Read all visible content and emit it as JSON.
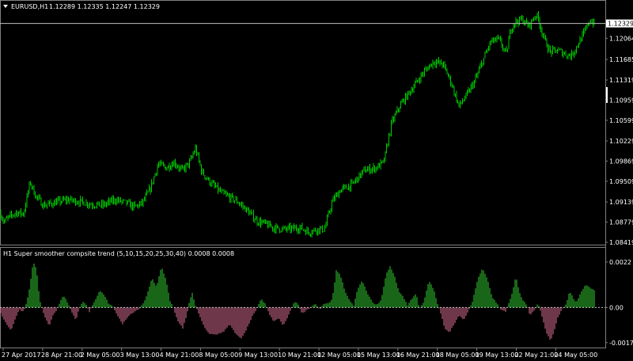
{
  "main_panel": {
    "symbol_label": "EURUSD,H1",
    "ohlc": "1.12289 1.12335 1.12247 1.12329",
    "current_price": "1.12329",
    "price_axis": [
      "1.12409",
      "1.12064",
      "1.11685",
      "1.11319",
      "1.10959",
      "1.10599",
      "1.10229",
      "1.09869",
      "1.09509",
      "1.09139",
      "1.08779",
      "1.08419"
    ]
  },
  "indicator_panel": {
    "title": "H1 Super smoother compsite trend (5,10,15,20,25,30,40) 0.0008 0.0008",
    "axis": [
      "0.0022",
      "0.00",
      "-0.0017"
    ]
  },
  "time_axis": [
    "27 Apr 2017",
    "28 Apr 21:00",
    "2 May 05:00",
    "3 May 13:00",
    "4 May 21:00",
    "8 May 05:00",
    "9 May 13:00",
    "10 May 21:00",
    "12 May 05:00",
    "15 May 13:00",
    "16 May 21:00",
    "18 May 05:00",
    "19 May 13:00",
    "22 May 21:00",
    "24 May 05:00"
  ],
  "colors": {
    "background": "#000000",
    "candle": "#00c800",
    "grid_line": "#c0c0c0",
    "hist_positive": "#32cd32",
    "hist_negative": "#db7093",
    "text": "#ffffff"
  },
  "chart_data": [
    {
      "type": "candlestick",
      "title": "EURUSD,H1",
      "ylim": [
        1.0842,
        1.1255
      ],
      "current_price": 1.12329,
      "x_tick_labels": [
        "27 Apr 2017",
        "28 Apr 21:00",
        "2 May 05:00",
        "3 May 13:00",
        "4 May 21:00",
        "8 May 05:00",
        "9 May 13:00",
        "10 May 21:00",
        "12 May 05:00",
        "15 May 13:00",
        "16 May 21:00",
        "18 May 05:00",
        "19 May 13:00",
        "22 May 21:00",
        "24 May 05:00"
      ],
      "close_path": [
        [
          0,
          1.0895
        ],
        [
          2,
          1.0888
        ],
        [
          5,
          1.0878
        ],
        [
          10,
          1.0885
        ],
        [
          20,
          1.0895
        ],
        [
          30,
          1.0893
        ],
        [
          38,
          1.095
        ],
        [
          45,
          1.0925
        ],
        [
          55,
          1.0908
        ],
        [
          70,
          1.0913
        ],
        [
          85,
          1.0918
        ],
        [
          100,
          1.0915
        ],
        [
          115,
          1.091
        ],
        [
          130,
          1.0908
        ],
        [
          145,
          1.0918
        ],
        [
          160,
          1.0912
        ],
        [
          170,
          1.0905
        ],
        [
          180,
          1.0912
        ],
        [
          190,
          1.0938
        ],
        [
          200,
          1.0982
        ],
        [
          210,
          1.0975
        ],
        [
          220,
          1.0985
        ],
        [
          230,
          1.097
        ],
        [
          240,
          1.0985
        ],
        [
          247,
          1.101
        ],
        [
          255,
          1.0968
        ],
        [
          265,
          1.095
        ],
        [
          280,
          1.093
        ],
        [
          300,
          1.0915
        ],
        [
          315,
          1.0895
        ],
        [
          325,
          1.088
        ],
        [
          335,
          1.0875
        ],
        [
          345,
          1.0868
        ],
        [
          360,
          1.0865
        ],
        [
          380,
          1.0868
        ],
        [
          390,
          1.086
        ],
        [
          400,
          1.0865
        ],
        [
          410,
          1.0865
        ],
        [
          420,
          1.0915
        ],
        [
          430,
          1.0935
        ],
        [
          445,
          1.0945
        ],
        [
          460,
          1.097
        ],
        [
          475,
          1.0975
        ],
        [
          485,
          1.0985
        ],
        [
          495,
          1.1055
        ],
        [
          505,
          1.1085
        ],
        [
          515,
          1.1105
        ],
        [
          525,
          1.1125
        ],
        [
          535,
          1.1145
        ],
        [
          548,
          1.1165
        ],
        [
          560,
          1.116
        ],
        [
          570,
          1.1128
        ],
        [
          580,
          1.1085
        ],
        [
          590,
          1.1105
        ],
        [
          600,
          1.113
        ],
        [
          610,
          1.1165
        ],
        [
          620,
          1.12
        ],
        [
          630,
          1.1205
        ],
        [
          640,
          1.1178
        ],
        [
          645,
          1.122
        ],
        [
          650,
          1.1235
        ],
        [
          660,
          1.124
        ],
        [
          668,
          1.1228
        ],
        [
          678,
          1.125
        ],
        [
          688,
          1.1205
        ],
        [
          695,
          1.1182
        ],
        [
          705,
          1.1185
        ],
        [
          715,
          1.1178
        ],
        [
          722,
          1.1175
        ],
        [
          730,
          1.1195
        ],
        [
          738,
          1.1215
        ],
        [
          745,
          1.1238
        ],
        [
          752,
          1.1233
        ]
      ]
    },
    {
      "type": "histogram",
      "title": "H1 Super smoother compsite trend (5,10,15,20,25,30,40) 0.0008 0.0008",
      "ylim": [
        -0.0019,
        0.00235
      ],
      "y_tick_labels": [
        "0.0022",
        "0.00",
        "-0.0017"
      ],
      "positive_color": "#32cd32",
      "negative_color": "#db7093",
      "profile": [
        [
          0,
          -0.0002
        ],
        [
          8,
          -0.0008
        ],
        [
          14,
          -0.0011
        ],
        [
          18,
          -0.0007
        ],
        [
          24,
          -0.0001
        ],
        [
          30,
          -0.0002
        ],
        [
          36,
          0.0006
        ],
        [
          42,
          0.0022
        ],
        [
          46,
          0.0019
        ],
        [
          50,
          0.0004
        ],
        [
          56,
          -0.0004
        ],
        [
          62,
          -0.0009
        ],
        [
          67,
          -0.0004
        ],
        [
          72,
          -0.0001
        ],
        [
          80,
          0.0006
        ],
        [
          86,
          0.0002
        ],
        [
          90,
          -0.0002
        ],
        [
          96,
          -0.0006
        ],
        [
          100,
          -0.0001
        ],
        [
          104,
          0.0003
        ],
        [
          108,
          0.0002
        ],
        [
          113,
          -0.0002
        ],
        [
          118,
          0.0002
        ],
        [
          126,
          0.0008
        ],
        [
          132,
          0.0006
        ],
        [
          137,
          0.0002
        ],
        [
          142,
          0.0001
        ],
        [
          147,
          -0.0003
        ],
        [
          155,
          -0.0008
        ],
        [
          163,
          -0.0004
        ],
        [
          170,
          -0.0002
        ],
        [
          176,
          -0.0001
        ],
        [
          184,
          0.0004
        ],
        [
          192,
          0.0014
        ],
        [
          198,
          0.001
        ],
        [
          204,
          0.002
        ],
        [
          210,
          0.0013
        ],
        [
          215,
          0.0003
        ],
        [
          218,
          0.0001
        ],
        [
          224,
          -0.0006
        ],
        [
          231,
          -0.001
        ],
        [
          236,
          -0.0004
        ],
        [
          240,
          0.0004
        ],
        [
          243,
          0.0007
        ],
        [
          247,
          0.0001
        ],
        [
          252,
          -0.0004
        ],
        [
          260,
          -0.0011
        ],
        [
          266,
          -0.0013
        ],
        [
          274,
          -0.0013
        ],
        [
          282,
          -0.0012
        ],
        [
          290,
          -0.0008
        ],
        [
          298,
          -0.0013
        ],
        [
          305,
          -0.0015
        ],
        [
          310,
          -0.0012
        ],
        [
          318,
          -0.0005
        ],
        [
          324,
          -0.0001
        ],
        [
          330,
          0.0004
        ],
        [
          335,
          0.0002
        ],
        [
          340,
          -0.0003
        ],
        [
          346,
          -0.0007
        ],
        [
          352,
          -0.0005
        ],
        [
          358,
          -0.0009
        ],
        [
          363,
          -0.0005
        ],
        [
          368,
          -0.0001
        ],
        [
          372,
          0.0003
        ],
        [
          376,
          0.0002
        ],
        [
          382,
          -0.0003
        ],
        [
          388,
          -0.0001
        ],
        [
          393,
          0.0
        ],
        [
          398,
          0.0002
        ],
        [
          404,
          -0.0001
        ],
        [
          410,
          0.0002
        ],
        [
          416,
          0.0002
        ],
        [
          420,
          0.0004
        ],
        [
          425,
          0.0018
        ],
        [
          430,
          0.0016
        ],
        [
          436,
          0.0008
        ],
        [
          442,
          0.0003
        ],
        [
          447,
          0.0001
        ],
        [
          452,
          0.0009
        ],
        [
          458,
          0.0013
        ],
        [
          464,
          0.0007
        ],
        [
          470,
          0.0003
        ],
        [
          476,
          0.0001
        ],
        [
          482,
          0.0004
        ],
        [
          488,
          0.0016
        ],
        [
          493,
          0.002
        ],
        [
          498,
          0.0016
        ],
        [
          504,
          0.0008
        ],
        [
          510,
          0.0005
        ],
        [
          515,
          0.0001
        ],
        [
          520,
          0.0004
        ],
        [
          526,
          0.0007
        ],
        [
          530,
          -0.0001
        ],
        [
          536,
          0.0003
        ],
        [
          542,
          0.0013
        ],
        [
          548,
          0.0009
        ],
        [
          552,
          0.0003
        ],
        [
          557,
          -0.0003
        ],
        [
          562,
          -0.001
        ],
        [
          568,
          -0.0012
        ],
        [
          574,
          -0.0008
        ],
        [
          580,
          -0.0004
        ],
        [
          586,
          -0.0006
        ],
        [
          592,
          -0.0002
        ],
        [
          597,
          0.0003
        ],
        [
          604,
          0.0014
        ],
        [
          610,
          0.0019
        ],
        [
          616,
          0.0014
        ],
        [
          622,
          0.0005
        ],
        [
          628,
          0.0002
        ],
        [
          633,
          -0.0001
        ],
        [
          639,
          -0.0002
        ],
        [
          646,
          0.0005
        ],
        [
          652,
          0.0015
        ],
        [
          656,
          0.0008
        ],
        [
          660,
          0.0004
        ],
        [
          666,
          0.0001
        ],
        [
          670,
          -0.0004
        ],
        [
          676,
          -0.0001
        ],
        [
          680,
          0.0002
        ],
        [
          684,
          -0.0003
        ],
        [
          690,
          -0.0012
        ],
        [
          696,
          -0.0016
        ],
        [
          700,
          -0.0012
        ],
        [
          705,
          -0.0005
        ],
        [
          710,
          -0.0001
        ],
        [
          716,
          0.0002
        ],
        [
          720,
          0.0008
        ],
        [
          724,
          0.0005
        ],
        [
          728,
          0.0002
        ],
        [
          734,
          0.0007
        ],
        [
          740,
          0.0011
        ],
        [
          748,
          0.0009
        ],
        [
          752,
          0.0008
        ]
      ]
    }
  ]
}
